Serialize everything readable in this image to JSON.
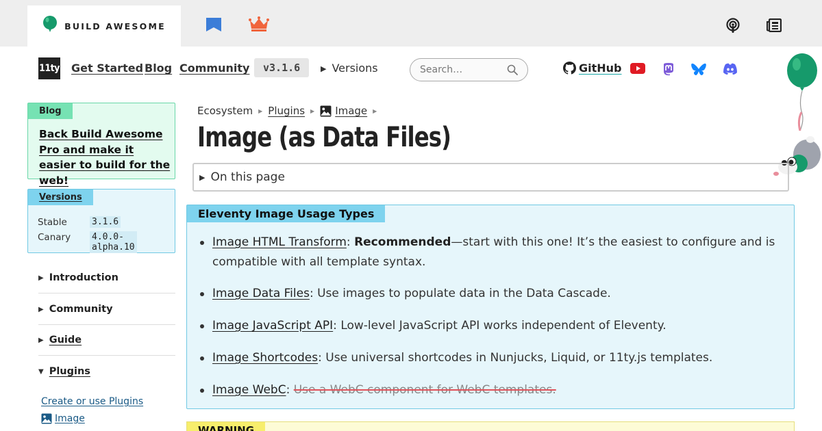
{
  "topbar": {
    "brand_label": "BUILD AWESOME",
    "icons": [
      "balloon-icon",
      "flag-icon",
      "crown-icon",
      "podcast-icon",
      "newspaper-icon"
    ],
    "colors": {
      "background": "#eeeeee",
      "balloon": "#169a6b",
      "flag": "#3b7dd8",
      "crown": "#f0643c"
    }
  },
  "nav": {
    "logo_text": "11ty",
    "links": [
      "Get Started",
      "Blog",
      "Community"
    ],
    "version": "v3.1.6",
    "versions_toggle": "Versions",
    "search_placeholder": "Search…",
    "github_label": "GitHub",
    "social_icons": [
      "youtube-icon",
      "mastodon-icon",
      "bluesky-icon",
      "discord-icon"
    ],
    "colors": {
      "youtube": "#e01b24",
      "mastodon": "#7d5bd8",
      "bluesky": "#1185fe",
      "discord": "#5865f2"
    }
  },
  "sidebar": {
    "blog_card": {
      "tag": "Blog",
      "text": "Back Build Awesome Pro and make it easier to build for the web!"
    },
    "versions_card": {
      "tag": "Versions",
      "rows": [
        {
          "label": "Stable",
          "value": "3.1.6"
        },
        {
          "label": "Canary",
          "value": "4.0.0-alpha.10"
        }
      ]
    },
    "items": [
      {
        "label": "Introduction",
        "expanded": false
      },
      {
        "label": "Community",
        "expanded": false
      },
      {
        "label": "Guide",
        "expanded": false
      },
      {
        "label": "Plugins",
        "expanded": true
      }
    ],
    "sublinks": [
      "Create or use Plugins",
      "Image"
    ]
  },
  "main": {
    "breadcrumb": [
      "Ecosystem",
      "Plugins",
      "Image"
    ],
    "title": "Image (as Data Files)",
    "toc_label": "On this page",
    "usage_box": {
      "tag": "Eleventy Image Usage Types",
      "items": [
        {
          "link": "Image HTML Transform",
          "sep": ": ",
          "bold": "Recommended",
          "text": "—start with this one! It’s the easiest to configure and is compatible with all template syntax."
        },
        {
          "link": "Image Data Files",
          "sep": ": ",
          "text": "Use images to populate data in the Data Cascade."
        },
        {
          "link": "Image JavaScript API",
          "sep": ": ",
          "text": "Low-level JavaScript API works independent of Eleventy."
        },
        {
          "link": "Image Shortcodes",
          "sep": ": ",
          "text": "Use universal shortcodes in Nunjucks, Liquid, or 11ty.js templates."
        },
        {
          "link": "Image WebC",
          "sep": ": ",
          "strike": "Use a WebC component for WebC templates."
        }
      ]
    },
    "warning_tag": "WARNING"
  }
}
